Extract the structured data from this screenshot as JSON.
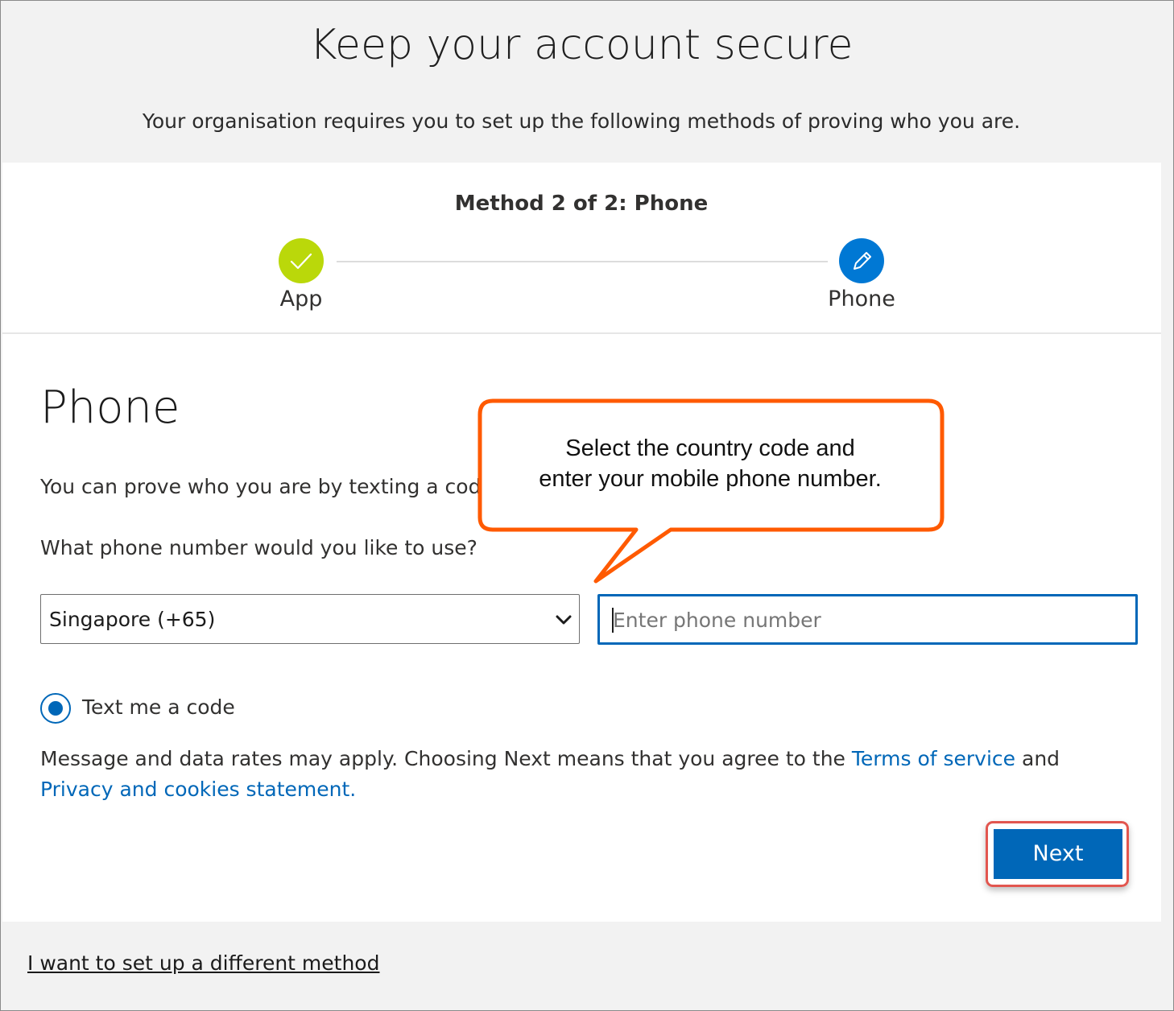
{
  "header": {
    "title": "Keep your account secure",
    "subtitle": "Your organisation requires you to set up the following methods of proving who you are."
  },
  "progress": {
    "title": "Method 2 of 2: Phone",
    "steps": [
      {
        "label": "App",
        "status": "completed",
        "icon": "checkmark-icon",
        "color": "#bad80a"
      },
      {
        "label": "Phone",
        "status": "current",
        "icon": "pencil-icon",
        "color": "#0078d4"
      }
    ]
  },
  "section": {
    "heading": "Phone",
    "description": "You can prove who you are by texting a cod",
    "question": "What phone number would you like to use?"
  },
  "form": {
    "country_value": "Singapore (+65)",
    "phone_placeholder": "Enter phone number",
    "phone_value": "",
    "radio_label": "Text me a code"
  },
  "legal": {
    "text_before": "Message and data rates may apply. Choosing Next means that you agree to the ",
    "terms_link": "Terms of service",
    "text_middle": " and ",
    "privacy_link": "Privacy and cookies statement."
  },
  "actions": {
    "next_label": "Next",
    "alt_method_link": "I want to set up a different method"
  },
  "callout": {
    "line1": "Select the country code and",
    "line2": "enter your mobile phone number.",
    "border_color": "#ff5a00"
  },
  "colors": {
    "accent": "#0067b8",
    "link": "#0067b8",
    "highlight": "#e2564f"
  }
}
